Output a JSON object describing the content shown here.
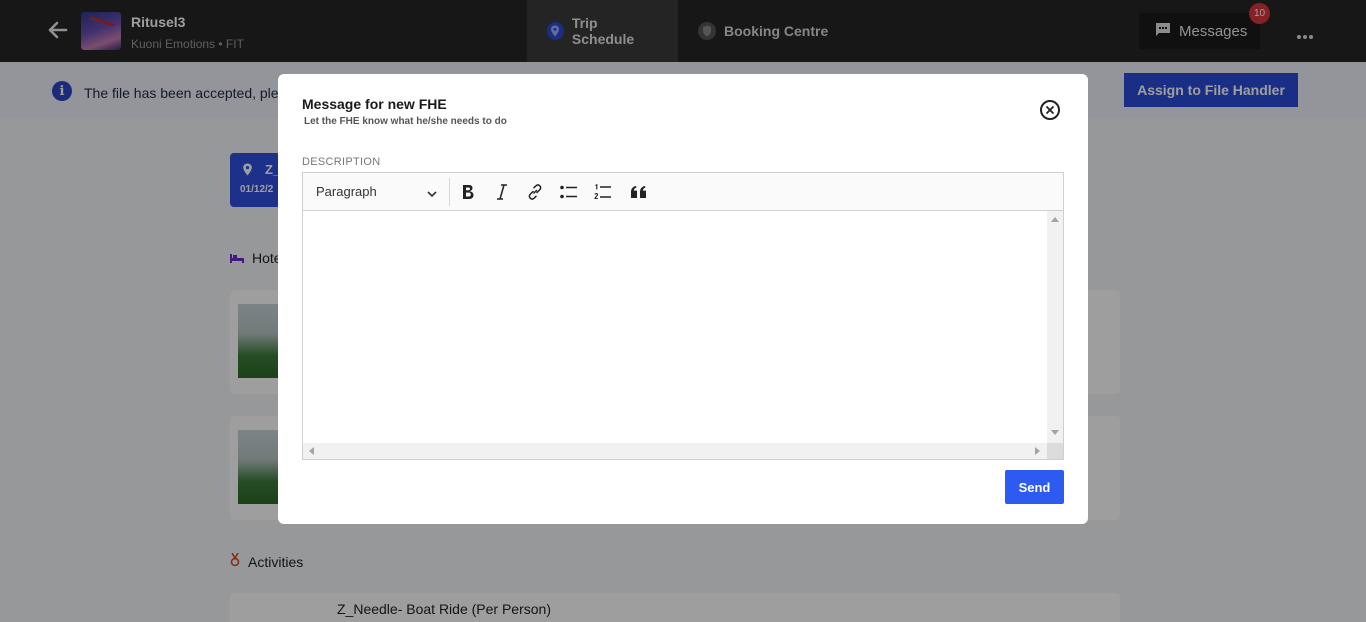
{
  "header": {
    "trip_title": "Ritusel3",
    "trip_subtitle": "Kuoni Emotions • FIT",
    "tabs": [
      {
        "label": "Trip Schedule",
        "active": true
      },
      {
        "label": "Booking Centre",
        "active": false
      }
    ],
    "messages_label": "Messages",
    "messages_count": "10"
  },
  "banner": {
    "text": "The file has been accepted, ple",
    "assign_label": "Assign to File Handler"
  },
  "background": {
    "day_title": "Z_",
    "day_date": "01/12/2",
    "hotels_label": "Hote",
    "activities_label": "Activities",
    "activity_item": "Z_Needle- Boat Ride (Per Person)"
  },
  "modal": {
    "title": "Message for new FHE",
    "subtitle": "Let the FHE know what he/she needs to do",
    "description_label": "DESCRIPTION",
    "paragraph_select": "Paragraph",
    "toolbar": [
      "bold-icon",
      "italic-icon",
      "link-icon",
      "bulleted-list-icon",
      "numbered-list-icon",
      "blockquote-icon"
    ],
    "editor_value": "",
    "send_label": "Send"
  },
  "colors": {
    "topbar": "#262626",
    "accent": "#2d5af0",
    "badge": "#d9383c",
    "banner": "#eef1fb"
  }
}
